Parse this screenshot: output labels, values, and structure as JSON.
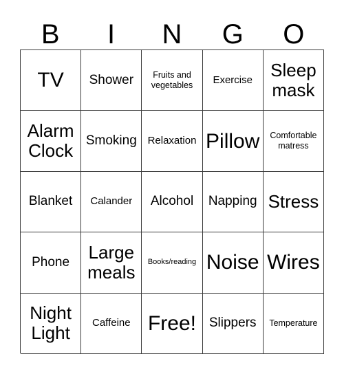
{
  "card": {
    "header_letters": [
      "B",
      "I",
      "N",
      "G",
      "O"
    ],
    "rows": [
      [
        {
          "text": "TV",
          "size": "xl"
        },
        {
          "text": "Shower",
          "size": "md"
        },
        {
          "text": "Fruits and vegetables",
          "size": "xs"
        },
        {
          "text": "Exercise",
          "size": "sm"
        },
        {
          "text": "Sleep mask",
          "size": "lg"
        }
      ],
      [
        {
          "text": "Alarm Clock",
          "size": "lg"
        },
        {
          "text": "Smoking",
          "size": "md"
        },
        {
          "text": "Relaxation",
          "size": "sm"
        },
        {
          "text": "Pillow",
          "size": "xl"
        },
        {
          "text": "Comfortable matress",
          "size": "xs"
        }
      ],
      [
        {
          "text": "Blanket",
          "size": "md"
        },
        {
          "text": "Calander",
          "size": "sm"
        },
        {
          "text": "Alcohol",
          "size": "md"
        },
        {
          "text": "Napping",
          "size": "md"
        },
        {
          "text": "Stress",
          "size": "lg"
        }
      ],
      [
        {
          "text": "Phone",
          "size": "md"
        },
        {
          "text": "Large meals",
          "size": "lg"
        },
        {
          "text": "Books/reading",
          "size": "xxs"
        },
        {
          "text": "Noise",
          "size": "xl"
        },
        {
          "text": "Wires",
          "size": "xl"
        }
      ],
      [
        {
          "text": "Night Light",
          "size": "lg"
        },
        {
          "text": "Caffeine",
          "size": "sm"
        },
        {
          "text": "Free!",
          "size": "xl"
        },
        {
          "text": "Slippers",
          "size": "md"
        },
        {
          "text": "Temperature",
          "size": "xs"
        }
      ]
    ]
  },
  "colors": {
    "grid_line": "#3a3a3a",
    "text": "#000000",
    "background": "#ffffff"
  }
}
